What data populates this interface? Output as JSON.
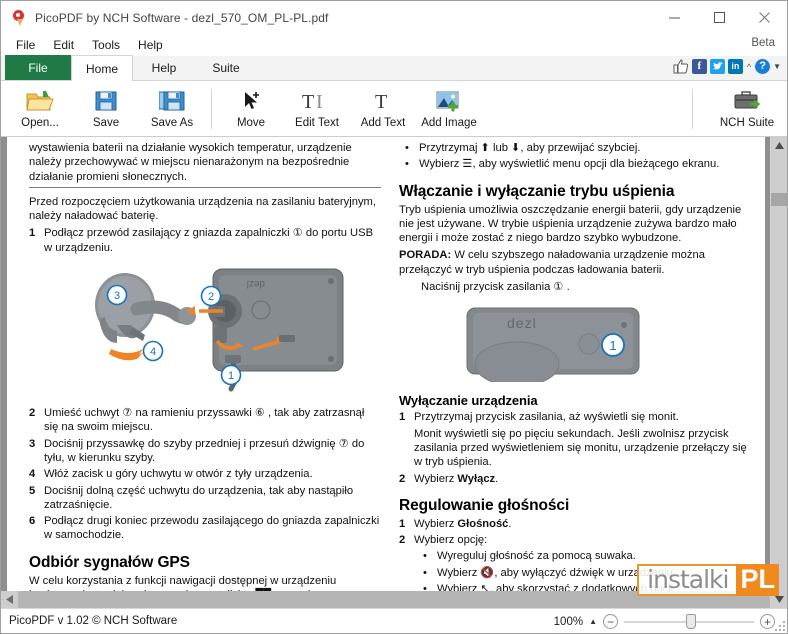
{
  "window": {
    "title": "PicoPDF by NCH Software - dezl_570_OM_PL-PL.pdf",
    "app_icon": "pin-icon",
    "minimize_label": "Minimize",
    "maximize_label": "Maximize",
    "close_label": "Close"
  },
  "menubar": {
    "items": [
      "File",
      "Edit",
      "Tools",
      "Help"
    ],
    "beta": "Beta"
  },
  "ribbon": {
    "tabs": [
      {
        "label": "File",
        "active": false,
        "style": "file"
      },
      {
        "label": "Home",
        "active": true,
        "style": "normal"
      },
      {
        "label": "Help",
        "active": false,
        "style": "normal"
      },
      {
        "label": "Suite",
        "active": false,
        "style": "normal"
      }
    ],
    "social": [
      {
        "name": "thumbs-up-icon",
        "label": ""
      },
      {
        "name": "facebook-icon",
        "label": "f"
      },
      {
        "name": "twitter-icon",
        "label": ""
      },
      {
        "name": "linkedin-icon",
        "label": "in"
      },
      {
        "name": "chevron-up-icon",
        "label": "^"
      },
      {
        "name": "help-icon",
        "label": "?"
      },
      {
        "name": "dropdown-arrow-icon",
        "label": "▼"
      }
    ]
  },
  "toolbar": {
    "items": [
      {
        "label": "Open...",
        "icon": "open-folder-icon"
      },
      {
        "label": "Save",
        "icon": "save-disk-icon"
      },
      {
        "label": "Save As",
        "icon": "save-as-icon"
      },
      {
        "label": "Move",
        "icon": "move-cursor-icon"
      },
      {
        "label": "Edit Text",
        "icon": "edit-text-icon"
      },
      {
        "label": "Add Text",
        "icon": "add-text-icon"
      },
      {
        "label": "Add Image",
        "icon": "add-image-icon"
      }
    ],
    "suite": {
      "label": "NCH Suite",
      "icon": "briefcase-icon"
    }
  },
  "document": {
    "left_column": {
      "top_paragraph": "wystawienia baterii na działanie wysokich temperatur, urządzenie należy przechowywać w miejscu nienarażonym na bezpośrednie działanie promieni słonecznych.",
      "charge_intro": "Przed rozpoczęciem użytkowania urządzenia na zasilaniu bateryjnym, należy naładować baterię.",
      "step1": {
        "n": "1",
        "text": "Podłącz przewód zasilający z gniazda zapalniczki ① do portu USB w urządzeniu."
      },
      "figure_mount_alt": "Diagram montażu uchwytu z przyssawką i urządzenia dezl, numery 1 2 3 4",
      "steps": [
        {
          "n": "2",
          "text": "Umieść uchwyt ⑦ na ramieniu przyssawki ⑥ , tak aby zatrzasnął się na swoim miejscu."
        },
        {
          "n": "3",
          "text": "Dociśnij przyssawkę do szyby przedniej i przesuń dźwignię ⑦ do tyłu, w kierunku szyby."
        },
        {
          "n": "4",
          "text": "Włóż zacisk u góry uchwytu w otwór z tyły urządzenia."
        },
        {
          "n": "5",
          "text": "Dociśnij dolną część uchwytu do urządzenia, tak aby nastąpiło zatrzaśnięcie."
        },
        {
          "n": "6",
          "text": "Podłącz drugi koniec przewodu zasilającego do gniazda zapalniczki w samochodzie."
        }
      ],
      "gps_heading": "Odbiór sygnałów GPS",
      "gps_text": "W celu korzystania z funkcji nawigacji dostępnej w urządzeniu konieczne jest odebranie sygnału z satelitów. ██ na pasku"
    },
    "right_column": {
      "bullets_top": [
        "Przytrzymaj ⬆ lub ⬇, aby przewijać szybciej.",
        "Wybierz ☰, aby wyświetlić menu opcji dla bieżącego ekranu."
      ],
      "sleep_heading": "Włączanie i wyłączanie trybu uśpienia",
      "sleep_text": "Tryb uśpienia umożliwia oszczędzanie energii baterii, gdy urządzenie nie jest używane. W trybie uśpienia urządzenie zużywa bardzo mało energii i może zostać z niego bardzo szybko wybudzone.",
      "tip_label": "PORADA:",
      "tip_text": " W celu szybszego naładowania urządzenie można przełączyć w tryb uśpienia podczas ładowania baterii.",
      "press_power": "Naciśnij przycisk zasilania ① .",
      "figure_device_alt": "Zdjęcie urządzenia dezl z przyciskiem zasilania oznaczonym numerem 1",
      "off_heading": "Wyłączanie urządzenia",
      "off_step1": {
        "n": "1",
        "text": "Przytrzymaj przycisk zasilania, aż wyświetli się monit."
      },
      "off_step1_note": "Monit wyświetli się po pięciu sekundach. Jeśli zwolnisz przycisk zasilania przed wyświetleniem się monitu, urządzenie przełączy się w tryb uśpienia.",
      "off_step2_prefix": "Wybierz ",
      "off_step2_bold": "Wyłącz",
      "off_step2_suffix": ".",
      "volume_heading": "Regulowanie głośności",
      "vol_step1_prefix": "Wybierz ",
      "vol_step1_bold": "Głośność",
      "vol_step1_suffix": ".",
      "vol_step2": "Wybierz opcję:",
      "vol_bullets": [
        "Wyreguluj głośność za pomocą suwaka.",
        "Wybierz 🔇, aby wyłączyć dźwięk w urządzeniu.",
        "Wybierz ↖, aby skorzystać z dodatkowych opcji."
      ]
    }
  },
  "watermark": {
    "text_left": "instalki",
    "text_right": "PL"
  },
  "statusbar": {
    "text": "PicoPDF v 1.02 © NCH Software",
    "zoom_percent": "100%",
    "zoom_out_label": "−",
    "zoom_in_label": "+"
  }
}
